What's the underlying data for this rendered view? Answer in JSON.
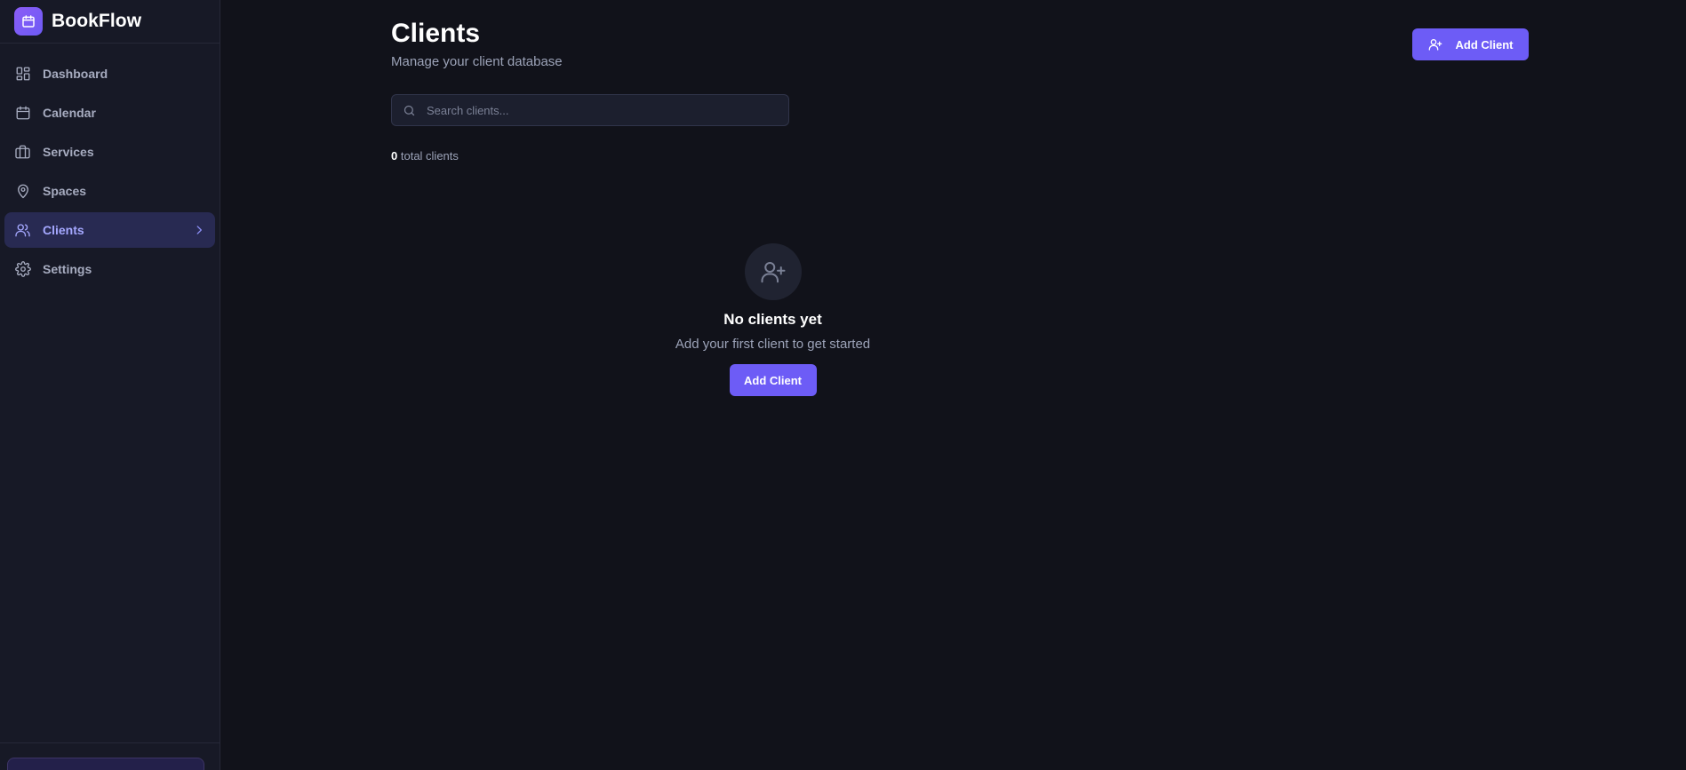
{
  "app": {
    "name": "BookFlow"
  },
  "sidebar": {
    "items": [
      {
        "label": "Dashboard",
        "icon": "dashboard-icon",
        "active": false
      },
      {
        "label": "Calendar",
        "icon": "calendar-icon",
        "active": false
      },
      {
        "label": "Services",
        "icon": "briefcase-icon",
        "active": false
      },
      {
        "label": "Spaces",
        "icon": "map-pin-icon",
        "active": false
      },
      {
        "label": "Clients",
        "icon": "users-icon",
        "active": true
      },
      {
        "label": "Settings",
        "icon": "gear-icon",
        "active": false
      }
    ]
  },
  "header": {
    "title": "Clients",
    "subtitle": "Manage your client database",
    "add_label": "Add Client"
  },
  "search": {
    "placeholder": "Search clients..."
  },
  "stats": {
    "count": "0",
    "count_label": "total clients"
  },
  "empty_state": {
    "title": "No clients yet",
    "subtitle": "Add your first client to get started",
    "button_label": "Add Client"
  },
  "colors": {
    "accent": "#6d5cf6",
    "active_nav_bg": "#282a52",
    "background": "#11121a",
    "sidebar": "#171926"
  }
}
